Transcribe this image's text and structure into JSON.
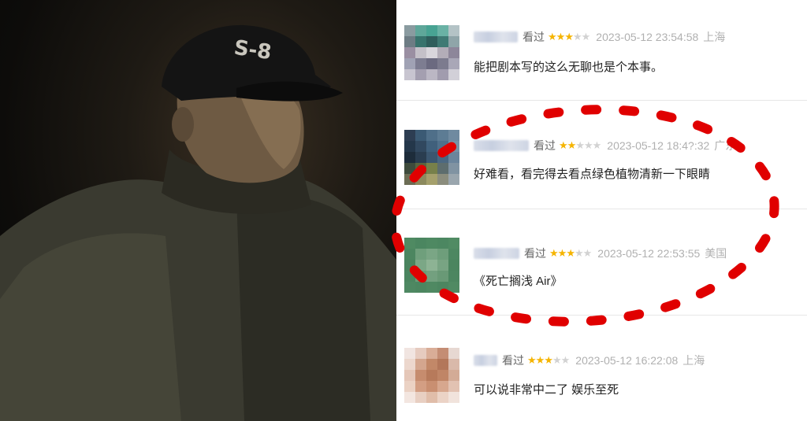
{
  "comments": [
    {
      "seen_label": "看过",
      "rating": 3,
      "max_rating": 5,
      "datetime": "2023-05-12 23:54:58",
      "location": "上海",
      "text": "能把剧本写的这么无聊也是个本事。"
    },
    {
      "seen_label": "看过",
      "rating": 2,
      "max_rating": 5,
      "datetime": "2023-05-12 18:4?:32",
      "location": "广东",
      "text": "好难看，看完得去看点绿色植物清新一下眼睛"
    },
    {
      "seen_label": "看过",
      "rating": 3,
      "max_rating": 5,
      "datetime": "2023-05-12 22:53:55",
      "location": "美国",
      "text": "《死亡搁浅 Air》"
    },
    {
      "seen_label": "看过",
      "rating": 3,
      "max_rating": 5,
      "datetime": "2023-05-12 16:22:08",
      "location": "上海",
      "text": "可以说非常中二了 娱乐至死"
    }
  ],
  "still": {
    "cap_text": "S-8"
  },
  "colors": {
    "star_on": "#f5b400",
    "star_off": "#d2d2d2",
    "annotation": "#e00000"
  },
  "icons": {
    "star": "star-icon",
    "annotation": "dashed-ellipse"
  }
}
